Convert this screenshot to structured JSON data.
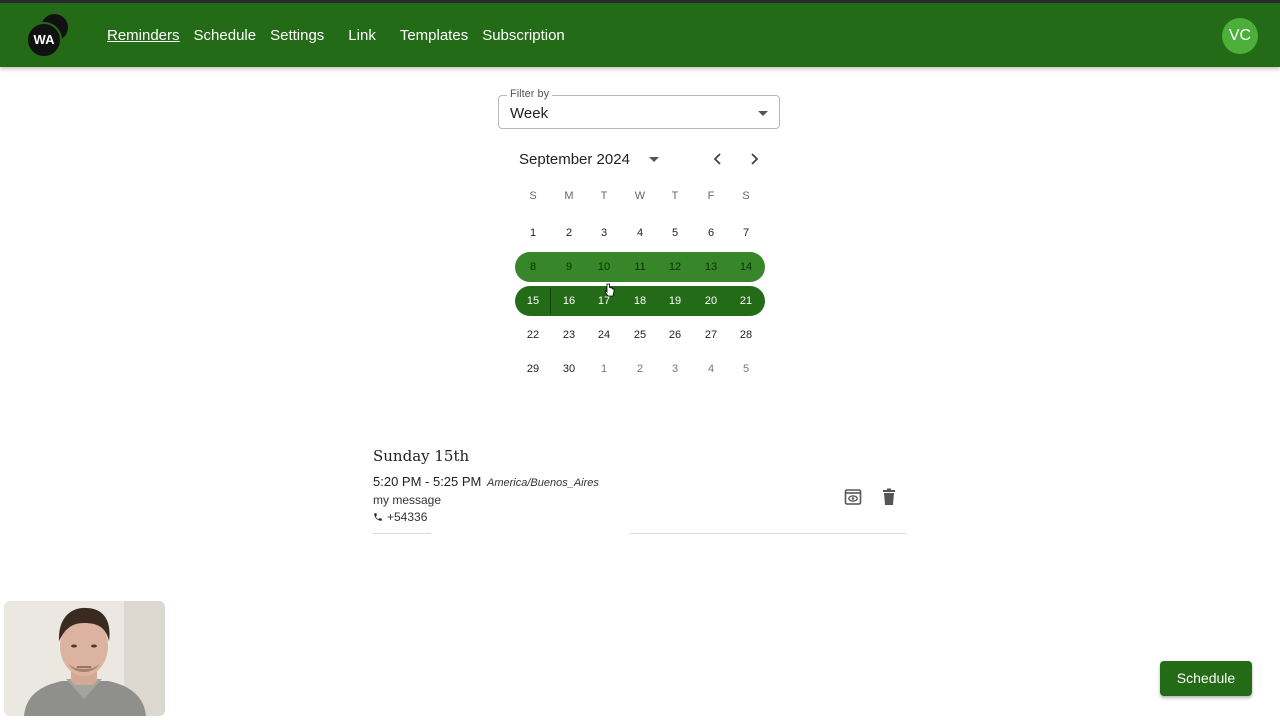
{
  "app": {
    "logo_text": "WA",
    "avatar_initials": "VC"
  },
  "nav": {
    "items": [
      "Reminders",
      "Schedule",
      "Settings",
      "Link",
      "Templates",
      "Subscription"
    ],
    "active": "Reminders"
  },
  "filter": {
    "label": "Filter by",
    "value": "Week"
  },
  "calendar": {
    "month": "September 2024",
    "weekdays": [
      "S",
      "M",
      "T",
      "W",
      "T",
      "F",
      "S"
    ],
    "weeks": [
      [
        "1",
        "2",
        "3",
        "4",
        "5",
        "6",
        "7"
      ],
      [
        "8",
        "9",
        "10",
        "11",
        "12",
        "13",
        "14"
      ],
      [
        "15",
        "16",
        "17",
        "18",
        "19",
        "20",
        "21"
      ],
      [
        "22",
        "23",
        "24",
        "25",
        "26",
        "27",
        "28"
      ],
      [
        "29",
        "30",
        "1",
        "2",
        "3",
        "4",
        "5"
      ]
    ],
    "highlighted_weeks": [
      1,
      2
    ],
    "selected_week": 2,
    "trailing_days_from_next_month": 5
  },
  "entry": {
    "day_title": "Sunday 15th",
    "time_range": "5:20 PM - 5:25 PM",
    "timezone": "America/Buenos_Aires",
    "message": "my message",
    "phone": "+54336"
  },
  "fab": {
    "label": "Schedule"
  },
  "colors": {
    "primary": "#246b17",
    "highlight": "#37862a",
    "avatar": "#4caf3a"
  }
}
